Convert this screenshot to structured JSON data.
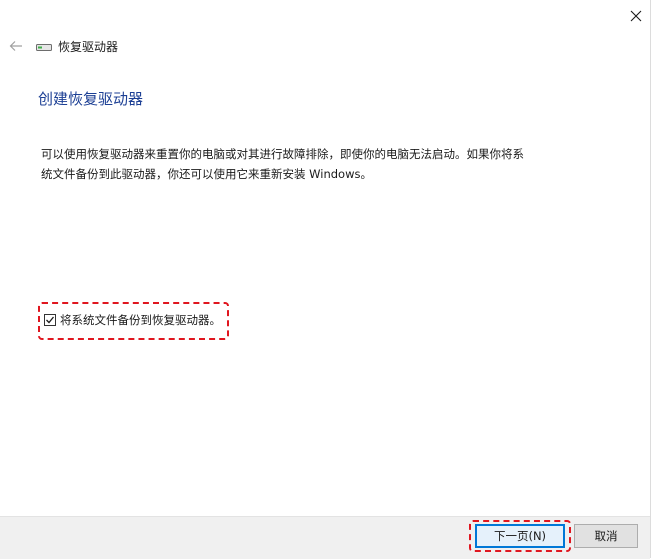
{
  "window": {
    "app_title": "恢复驱动器",
    "close_icon": "close-icon",
    "back_icon": "back-arrow-icon",
    "app_icon": "drive-icon"
  },
  "main": {
    "heading": "创建恢复驱动器",
    "description_line1": "可以使用恢复驱动器来重置你的电脑或对其进行故障排除，即使你的电脑无法启动。如果你将系",
    "description_line2": "统文件备份到此驱动器，你还可以使用它来重新安装 Windows。",
    "checkbox": {
      "label": "将系统文件备份到恢复驱动器。",
      "checked": true
    }
  },
  "footer": {
    "next_label": "下一页(N)",
    "cancel_label": "取消"
  },
  "colors": {
    "heading": "#1c3f94",
    "highlight": "#e0161f",
    "accent": "#0078d7"
  }
}
